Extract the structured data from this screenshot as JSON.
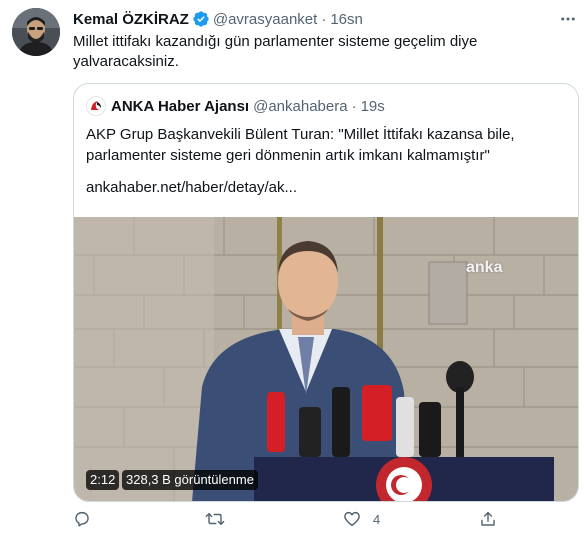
{
  "tweet": {
    "author_name": "Kemal ÖZKİRAZ",
    "handle": "@avrasyaanket",
    "separator": "·",
    "time": "16sn",
    "text": "Millet ittifakı kazandığı gün parlamenter sisteme geçelim diye yalvaracaksiniz."
  },
  "quote": {
    "author_name": "ANKA Haber Ajansı",
    "handle": "@ankahabera",
    "separator": "·",
    "time": "19s",
    "text": "AKP Grup Başkanvekili Bülent Turan: \"Millet İttifakı kazansa bile, parlamenter sisteme geri dönmenin artık imkanı kalmamıştır\"",
    "link": "ankahaber.net/haber/detay/ak...",
    "video": {
      "watermark": "anka",
      "duration": "2:12",
      "views": "328,3 B görüntülenme"
    }
  },
  "actions": {
    "reply_count": "",
    "retweet_count": "",
    "like_count": "4"
  },
  "colors": {
    "verified": "#1d9bf0",
    "text_primary": "#0f1419",
    "text_secondary": "#536471",
    "border": "#cfd9de",
    "anka_red": "#d51f26"
  },
  "icons": [
    "avatar",
    "verified-icon",
    "more-icon",
    "anka-logo-icon",
    "reply-icon",
    "retweet-icon",
    "like-icon",
    "share-icon"
  ]
}
